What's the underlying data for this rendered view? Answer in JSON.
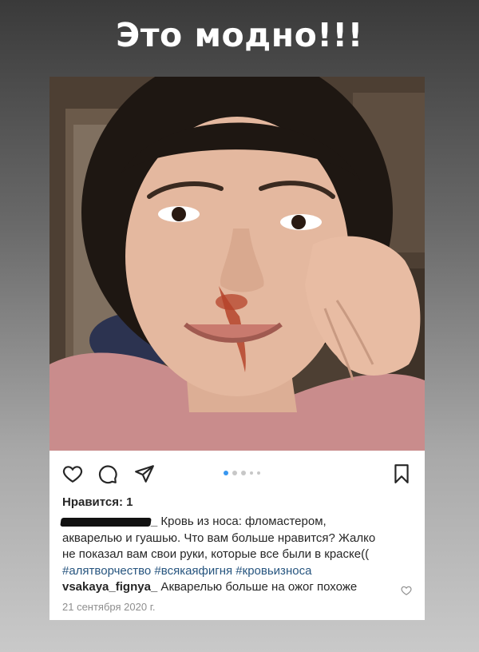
{
  "story": {
    "title": "Это модно!!!"
  },
  "post": {
    "likes_text": "Нравится: 1",
    "caption": {
      "username_suffix": "_",
      "text_line1": " Кровь из носа: фломастером,",
      "text_line2": "акварелью и гуашью. Что вам больше нравится? Жалко",
      "text_line3": "не показал вам свои руки, которые все были в краске((",
      "hashtags": "#алятворчество #всякаяфигня #кровьизноса"
    },
    "comment": {
      "username": "vsakaya_fignya_",
      "text": " Акварелью больше на ожог похоже"
    },
    "date": "21 сентября 2020 г.",
    "carousel": {
      "total_dots": 5,
      "active_index": 0
    }
  },
  "icons": {
    "like": "heart-icon",
    "comment": "comment-icon",
    "share": "send-icon",
    "save": "bookmark-icon",
    "comment_like": "small-heart-icon"
  },
  "colors": {
    "hashtag": "#27557f",
    "carousel_active": "#3897f0"
  }
}
